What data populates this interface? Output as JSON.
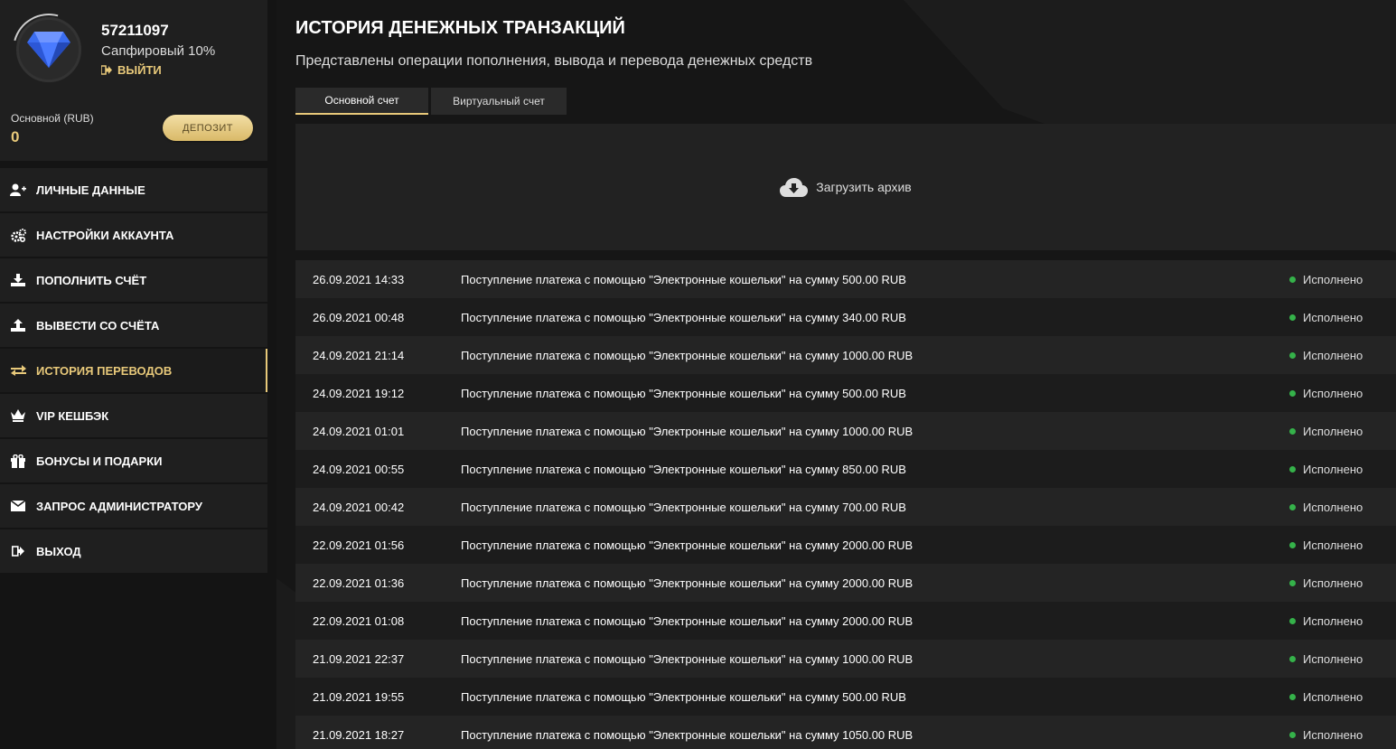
{
  "profile": {
    "user_id": "57211097",
    "level": "Сапфировый 10%",
    "logout_label": "ВЫЙТИ",
    "balance_label": "Основной (RUB)",
    "balance_value": "0",
    "deposit_label": "ДЕПОЗИТ"
  },
  "menu": [
    {
      "label": "ЛИЧНЫЕ ДАННЫЕ",
      "icon": "user-plus-icon"
    },
    {
      "label": "НАСТРОЙКИ АККАУНТА",
      "icon": "gears-icon"
    },
    {
      "label": "ПОПОЛНИТЬ СЧЁТ",
      "icon": "download-icon"
    },
    {
      "label": "ВЫВЕСТИ СО СЧЁТА",
      "icon": "upload-icon"
    },
    {
      "label": "ИСТОРИЯ ПЕРЕВОДОВ",
      "icon": "exchange-icon"
    },
    {
      "label": "VIP КЕШБЭК",
      "icon": "crown-icon"
    },
    {
      "label": "БОНУСЫ И ПОДАРКИ",
      "icon": "gift-icon"
    },
    {
      "label": "ЗАПРОС АДМИНИСТРАТОРУ",
      "icon": "envelope-icon"
    },
    {
      "label": "ВЫХОД",
      "icon": "sign-out-icon"
    }
  ],
  "main": {
    "title": "ИСТОРИЯ ДЕНЕЖНЫХ ТРАНЗАКЦИЙ",
    "subtitle": "Представлены операции пополнения, вывода и перевода денежных средств",
    "tabs": [
      "Основной счет",
      "Виртуальный счет"
    ],
    "archive_label": "Загрузить архив",
    "transactions": [
      {
        "date": "26.09.2021 14:33",
        "desc": "Поступление платежа с помощью \"Электронные кошельки\" на сумму 500.00 RUB",
        "status": "Исполнено"
      },
      {
        "date": "26.09.2021 00:48",
        "desc": "Поступление платежа с помощью \"Электронные кошельки\" на сумму 340.00 RUB",
        "status": "Исполнено"
      },
      {
        "date": "24.09.2021 21:14",
        "desc": "Поступление платежа с помощью \"Электронные кошельки\" на сумму 1000.00 RUB",
        "status": "Исполнено"
      },
      {
        "date": "24.09.2021 19:12",
        "desc": "Поступление платежа с помощью \"Электронные кошельки\" на сумму 500.00 RUB",
        "status": "Исполнено"
      },
      {
        "date": "24.09.2021 01:01",
        "desc": "Поступление платежа с помощью \"Электронные кошельки\" на сумму 1000.00 RUB",
        "status": "Исполнено"
      },
      {
        "date": "24.09.2021 00:55",
        "desc": "Поступление платежа с помощью \"Электронные кошельки\" на сумму 850.00 RUB",
        "status": "Исполнено"
      },
      {
        "date": "24.09.2021 00:42",
        "desc": "Поступление платежа с помощью \"Электронные кошельки\" на сумму 700.00 RUB",
        "status": "Исполнено"
      },
      {
        "date": "22.09.2021 01:56",
        "desc": "Поступление платежа с помощью \"Электронные кошельки\" на сумму 2000.00 RUB",
        "status": "Исполнено"
      },
      {
        "date": "22.09.2021 01:36",
        "desc": "Поступление платежа с помощью \"Электронные кошельки\" на сумму 2000.00 RUB",
        "status": "Исполнено"
      },
      {
        "date": "22.09.2021 01:08",
        "desc": "Поступление платежа с помощью \"Электронные кошельки\" на сумму 2000.00 RUB",
        "status": "Исполнено"
      },
      {
        "date": "21.09.2021 22:37",
        "desc": "Поступление платежа с помощью \"Электронные кошельки\" на сумму 1000.00 RUB",
        "status": "Исполнено"
      },
      {
        "date": "21.09.2021 19:55",
        "desc": "Поступление платежа с помощью \"Электронные кошельки\" на сумму 500.00 RUB",
        "status": "Исполнено"
      },
      {
        "date": "21.09.2021 18:27",
        "desc": "Поступление платежа с помощью \"Электронные кошельки\" на сумму 1050.00 RUB",
        "status": "Исполнено"
      }
    ]
  },
  "colors": {
    "accent_gold": "#e8c97a",
    "status_green": "#35b24a",
    "sapphire": "#3b6df0"
  }
}
